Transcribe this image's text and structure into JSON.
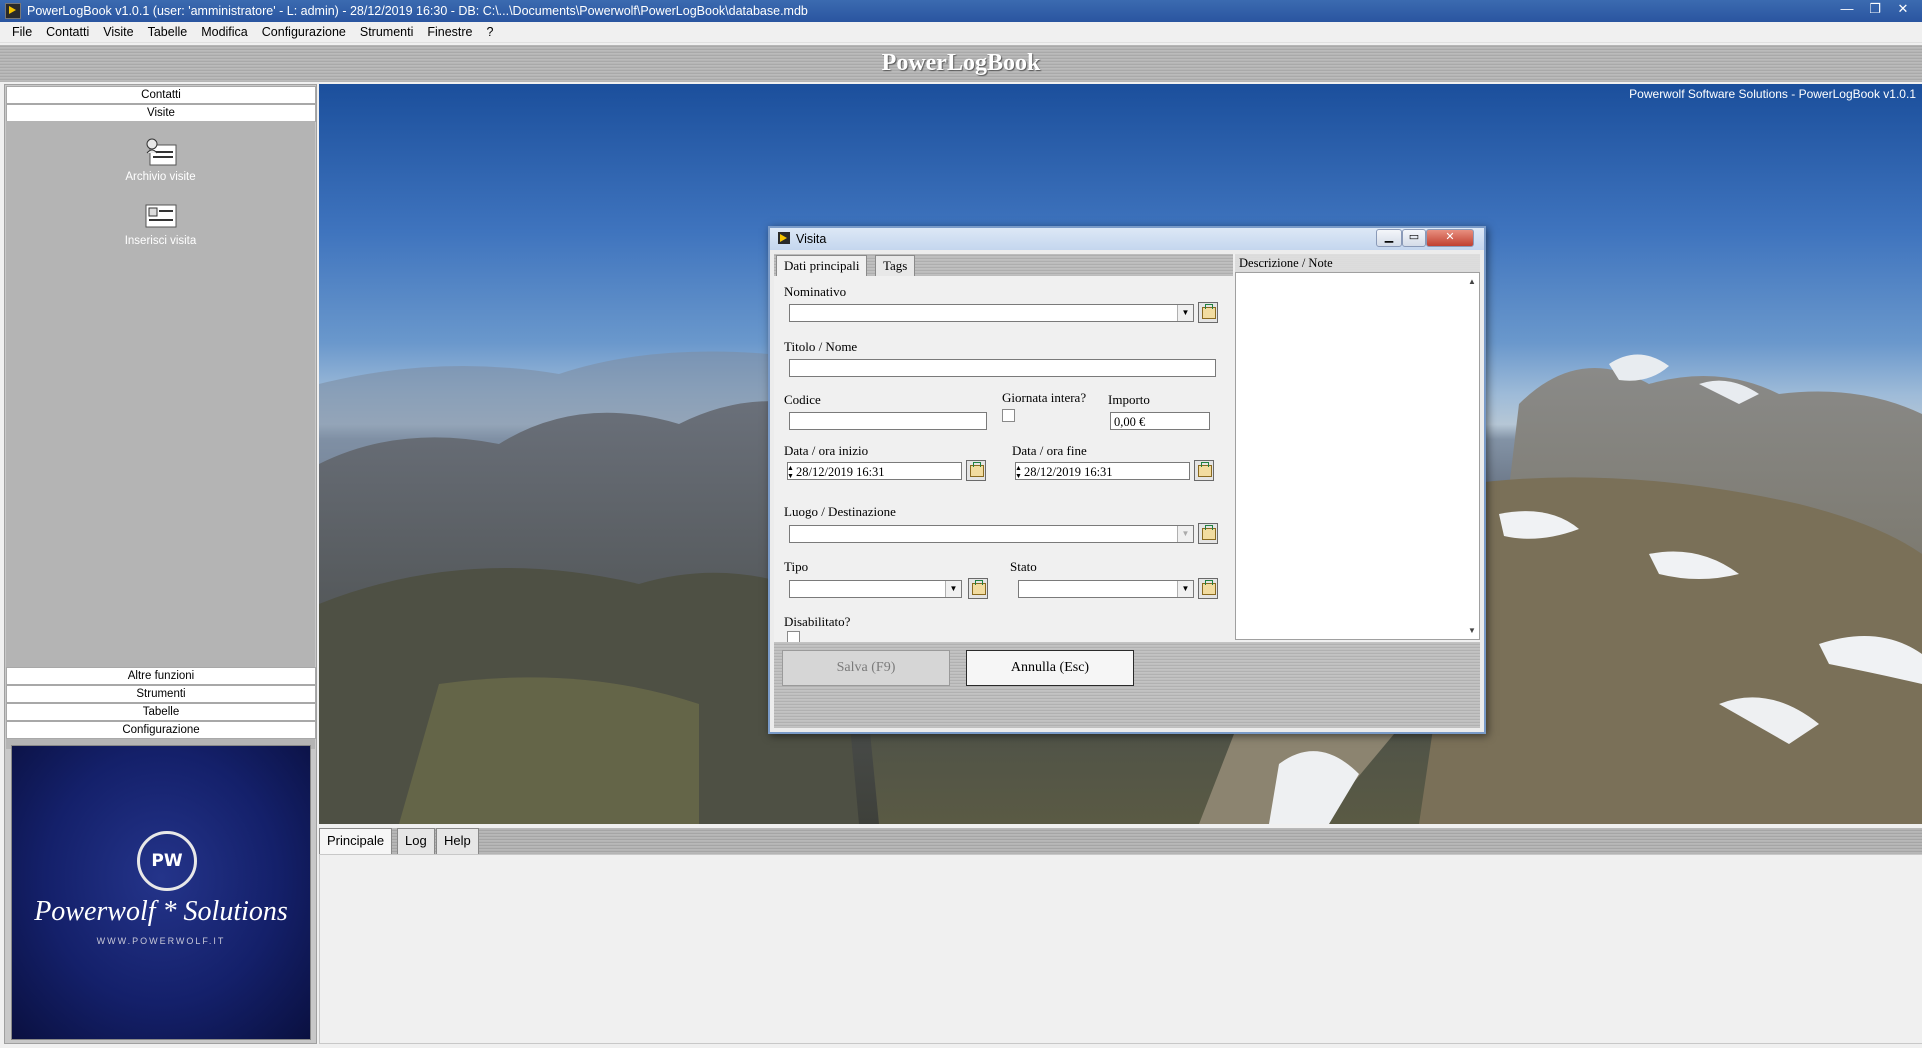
{
  "window": {
    "title": "PowerLogBook v1.0.1  (user: 'amministratore'  - L: admin) - 28/12/2019 16:30 - DB: C:\\...\\Documents\\Powerwolf\\PowerLogBook\\database.mdb",
    "minimize": "—",
    "restore": "❐",
    "close": "✕"
  },
  "menu": [
    "File",
    "Contatti",
    "Visite",
    "Tabelle",
    "Modifica",
    "Configurazione",
    "Strumenti",
    "Finestre",
    "?"
  ],
  "banner": "PowerLogBook",
  "sidebar": {
    "top_sections": [
      "Contatti",
      "Visite"
    ],
    "tools": [
      {
        "label": "Archivio visite",
        "icon": "archive-visits-icon"
      },
      {
        "label": "Inserisci visita",
        "icon": "insert-visit-icon"
      }
    ],
    "bottom_sections": [
      "Altre funzioni",
      "Strumenti",
      "Tabelle",
      "Configurazione"
    ],
    "logo": {
      "initials": "PW",
      "brand": "Powerwolf * Solutions",
      "url": "WWW.POWERWOLF.IT"
    }
  },
  "main": {
    "copyright": "Powerwolf Software Solutions - PowerLogBook v1.0.1",
    "bottom_tabs": [
      "Principale",
      "Log",
      "Help"
    ]
  },
  "dialog": {
    "title": "Visita",
    "tabs": [
      "Dati principali",
      "Tags"
    ],
    "notes_label": "Descrizione / Note",
    "fields": {
      "nominativo": {
        "label": "Nominativo",
        "value": ""
      },
      "titolo": {
        "label": "Titolo / Nome",
        "value": ""
      },
      "codice": {
        "label": "Codice",
        "value": ""
      },
      "giornata": {
        "label": "Giornata intera?",
        "checked": false
      },
      "importo": {
        "label": "Importo",
        "value": "0,00 €"
      },
      "data_inizio": {
        "label": "Data / ora inizio",
        "value": "28/12/2019 16:31"
      },
      "data_fine": {
        "label": "Data / ora fine",
        "value": "28/12/2019 16:31"
      },
      "luogo": {
        "label": "Luogo / Destinazione",
        "value": ""
      },
      "tipo": {
        "label": "Tipo",
        "value": ""
      },
      "stato": {
        "label": "Stato",
        "value": ""
      },
      "disabilitato": {
        "label": "Disabilitato?",
        "checked": false
      }
    },
    "buttons": {
      "save": "Salva (F9)",
      "cancel": "Annulla (Esc)"
    }
  }
}
